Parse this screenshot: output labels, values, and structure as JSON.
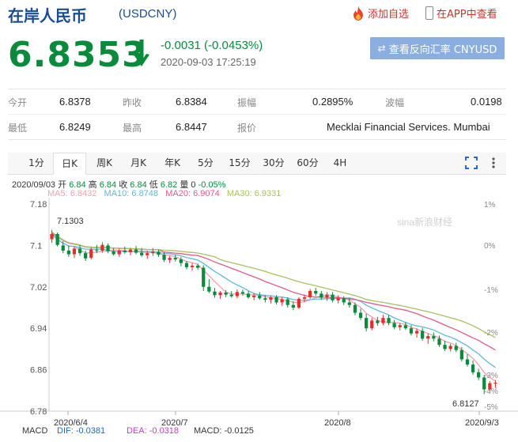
{
  "header": {
    "title": "在岸人民币",
    "code": "(USDCNY)",
    "add_watch": "添加自选",
    "open_app": "在APP中查看"
  },
  "quote": {
    "price": "6.8353",
    "direction": "down",
    "change": "-0.0031 (-0.0453%)",
    "time": "2020-09-03 17:25:19",
    "reverse_button": "查看反向汇率 CNYUSD"
  },
  "stats": {
    "open_label": "今开",
    "open": "6.8378",
    "prev_close_label": "昨收",
    "prev_close": "6.8384",
    "amplitude_label": "振幅",
    "amplitude": "0.2895%",
    "wave_label": "波幅",
    "wave": "0.0198",
    "low_label": "最低",
    "low": "6.8249",
    "high_label": "最高",
    "high": "6.8447",
    "quoter_label": "报价",
    "quoter": "Mecklai Financial Services. Mumbai"
  },
  "tabs": [
    "1分",
    "日K",
    "周K",
    "月K",
    "年K",
    "5分",
    "15分",
    "30分",
    "60分",
    "4H"
  ],
  "active_tab": "日K",
  "info": {
    "date": "2020/09/03",
    "open_label": "开",
    "open": "6.84",
    "high_label": "高",
    "high": "6.84",
    "close_label": "收",
    "close": "6.84",
    "low_label": "低",
    "low": "6.82",
    "vol_label": "量",
    "vol": "0",
    "pct": "-0.05%",
    "ma5": "MA5: 6.8432",
    "ma10": "MA10: 6.8748",
    "ma20": "MA20: 6.9074",
    "ma30": "MA30: 6.9331"
  },
  "macd": {
    "label": "MACD",
    "dif": "DIF: -0.0381",
    "dea": "DEA: -0.0318",
    "macd": "MACD: -0.0125"
  },
  "colors": {
    "up": "#e0302d",
    "down": "#0a8a3b",
    "ma5": "#f0a0b0",
    "ma10": "#5fb8d8",
    "ma20": "#e05a8c",
    "ma30": "#a8c060"
  },
  "chart_data": {
    "type": "candlestick",
    "watermark": "sina新浪财经",
    "y_ticks": [
      "7.18",
      "7.1",
      "7.02",
      "6.94",
      "6.86",
      "6.78"
    ],
    "y_tick_values": [
      7.18,
      7.1,
      7.02,
      6.94,
      6.86,
      6.78
    ],
    "pct_ticks": [
      "1%",
      "0%",
      "-1%",
      "-2%",
      "-3%",
      "-4%",
      "-5%"
    ],
    "x_ticks": [
      "2020/6/4",
      "2020/7",
      "2020/8",
      "2020/9/3"
    ],
    "high_marker": "7.1303",
    "low_marker": "6.8127",
    "ylim": [
      6.78,
      7.18
    ],
    "ohlc": [
      [
        7.112,
        7.13,
        7.105,
        7.122
      ],
      [
        7.122,
        7.125,
        7.098,
        7.101
      ],
      [
        7.1,
        7.108,
        7.085,
        7.09
      ],
      [
        7.09,
        7.1,
        7.078,
        7.083
      ],
      [
        7.083,
        7.098,
        7.076,
        7.094
      ],
      [
        7.094,
        7.101,
        7.08,
        7.085
      ],
      [
        7.085,
        7.09,
        7.07,
        7.075
      ],
      [
        7.076,
        7.096,
        7.073,
        7.092
      ],
      [
        7.091,
        7.101,
        7.085,
        7.09
      ],
      [
        7.09,
        7.106,
        7.086,
        7.101
      ],
      [
        7.1,
        7.104,
        7.085,
        7.089
      ],
      [
        7.089,
        7.095,
        7.08,
        7.083
      ],
      [
        7.083,
        7.094,
        7.078,
        7.09
      ],
      [
        7.09,
        7.098,
        7.084,
        7.087
      ],
      [
        7.087,
        7.095,
        7.081,
        7.092
      ],
      [
        7.092,
        7.099,
        7.083,
        7.086
      ],
      [
        7.086,
        7.095,
        7.078,
        7.081
      ],
      [
        7.081,
        7.09,
        7.074,
        7.085
      ],
      [
        7.085,
        7.095,
        7.08,
        7.088
      ],
      [
        7.088,
        7.092,
        7.078,
        7.082
      ],
      [
        7.082,
        7.087,
        7.068,
        7.072
      ],
      [
        7.072,
        7.08,
        7.066,
        7.076
      ],
      [
        7.076,
        7.082,
        7.069,
        7.073
      ],
      [
        7.073,
        7.078,
        7.06,
        7.066
      ],
      [
        7.066,
        7.07,
        7.054,
        7.058
      ],
      [
        7.058,
        7.066,
        7.051,
        7.061
      ],
      [
        7.061,
        7.065,
        7.053,
        7.057
      ],
      [
        7.057,
        7.062,
        7.012,
        7.02
      ],
      [
        7.02,
        7.035,
        7.008,
        7.011
      ],
      [
        7.011,
        7.018,
        6.999,
        7.004
      ],
      [
        7.004,
        7.012,
        6.997,
        7.009
      ],
      [
        7.009,
        7.014,
        7.0,
        7.005
      ],
      [
        7.005,
        7.012,
        6.999,
        7.002
      ],
      [
        7.002,
        7.015,
        6.998,
        7.01
      ],
      [
        7.01,
        7.015,
        7.003,
        7.007
      ],
      [
        7.007,
        7.012,
        6.997,
        7.0
      ],
      [
        7.0,
        7.008,
        6.994,
        7.003
      ],
      [
        7.003,
        7.01,
        6.995,
        6.998
      ],
      [
        6.998,
        7.004,
        6.99,
        6.995
      ],
      [
        6.995,
        7.003,
        6.988,
        7.0
      ],
      [
        7.0,
        7.004,
        6.986,
        6.99
      ],
      [
        6.99,
        7.001,
        6.984,
        6.996
      ],
      [
        6.996,
        7.0,
        6.98,
        6.985
      ],
      [
        6.985,
        6.992,
        6.975,
        6.98
      ],
      [
        6.98,
        7.0,
        6.977,
        6.997
      ],
      [
        6.997,
        7.005,
        6.99,
        7.0
      ],
      [
        7.0,
        7.016,
        6.997,
        7.012
      ],
      [
        7.012,
        7.018,
        7.003,
        7.007
      ],
      [
        7.007,
        7.012,
        6.995,
        6.999
      ],
      [
        6.999,
        7.01,
        6.993,
        7.005
      ],
      [
        7.005,
        7.01,
        6.99,
        6.994
      ],
      [
        6.994,
        7.004,
        6.988,
        6.998
      ],
      [
        6.998,
        7.002,
        6.985,
        6.99
      ],
      [
        6.99,
        6.998,
        6.98,
        6.985
      ],
      [
        6.985,
        6.99,
        6.965,
        6.97
      ],
      [
        6.97,
        6.978,
        6.956,
        6.96
      ],
      [
        6.96,
        6.968,
        6.934,
        6.94
      ],
      [
        6.94,
        6.96,
        6.936,
        6.955
      ],
      [
        6.955,
        6.962,
        6.945,
        6.95
      ],
      [
        6.95,
        6.966,
        6.946,
        6.96
      ],
      [
        6.96,
        6.966,
        6.946,
        6.95
      ],
      [
        6.95,
        6.956,
        6.938,
        6.942
      ],
      [
        6.942,
        6.95,
        6.936,
        6.946
      ],
      [
        6.946,
        6.952,
        6.937,
        6.94
      ],
      [
        6.94,
        6.946,
        6.926,
        6.93
      ],
      [
        6.93,
        6.94,
        6.922,
        6.935
      ],
      [
        6.935,
        6.941,
        6.916,
        6.92
      ],
      [
        6.92,
        6.93,
        6.91,
        6.925
      ],
      [
        6.925,
        6.932,
        6.915,
        6.92
      ],
      [
        6.92,
        6.926,
        6.904,
        6.908
      ],
      [
        6.908,
        6.916,
        6.896,
        6.9
      ],
      [
        6.9,
        6.91,
        6.895,
        6.906
      ],
      [
        6.906,
        6.912,
        6.894,
        6.898
      ],
      [
        6.898,
        6.904,
        6.876,
        6.88
      ],
      [
        6.88,
        6.89,
        6.866,
        6.87
      ],
      [
        6.87,
        6.878,
        6.85,
        6.855
      ],
      [
        6.855,
        6.862,
        6.84,
        6.845
      ],
      [
        6.845,
        6.85,
        6.813,
        6.822
      ],
      [
        6.822,
        6.838,
        6.818,
        6.834
      ],
      [
        6.834,
        6.84,
        6.825,
        6.835
      ]
    ]
  }
}
